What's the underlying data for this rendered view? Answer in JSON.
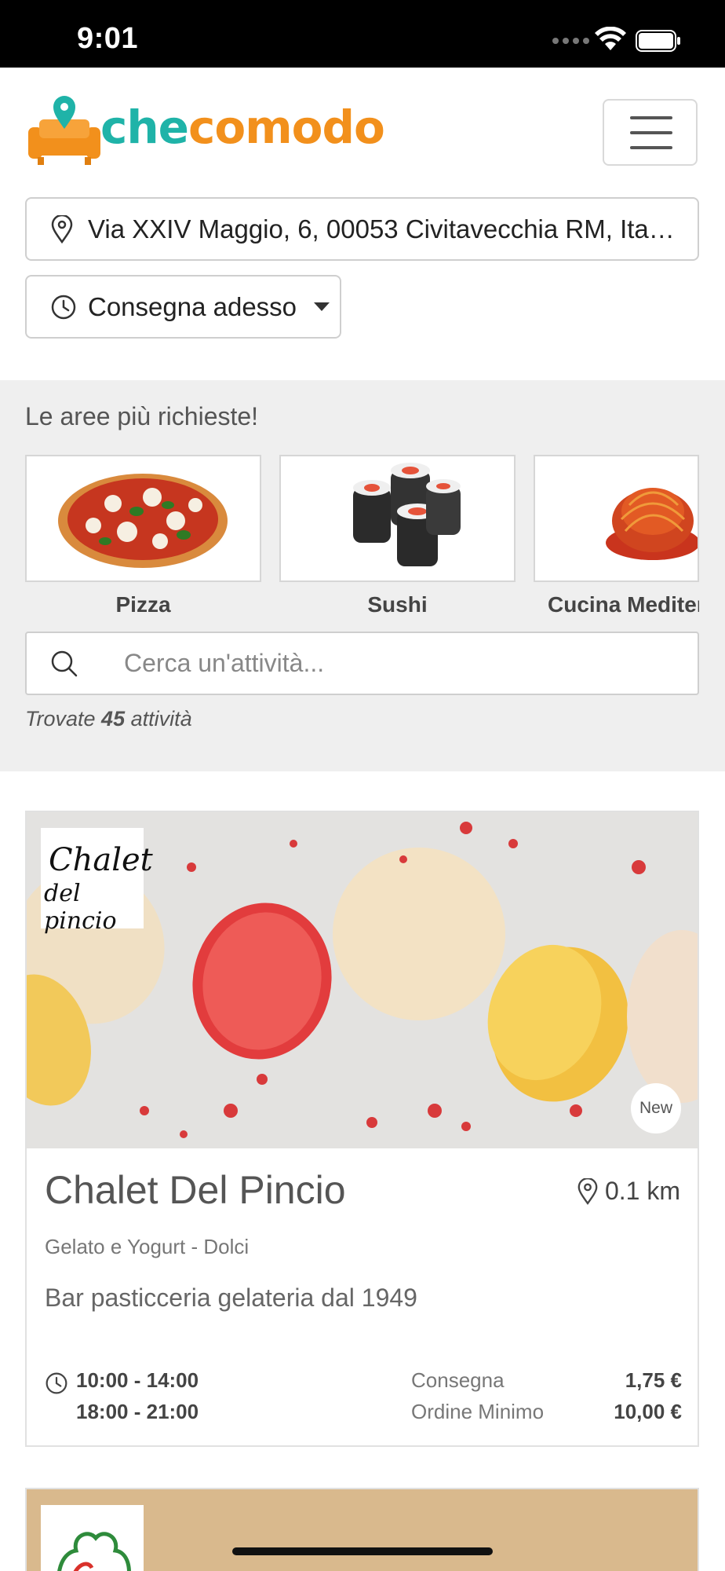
{
  "status_bar": {
    "time": "9:01"
  },
  "header": {
    "logo": {
      "part1": "che",
      "part2": "comodo"
    },
    "menu_icon": "hamburger-menu-icon"
  },
  "address": {
    "value": "Via XXIV Maggio, 6, 00053 Civitavecchia RM, Ita…"
  },
  "delivery": {
    "label": "Consegna adesso"
  },
  "areas": {
    "title": "Le aree più richieste!",
    "categories": [
      {
        "label": "Pizza"
      },
      {
        "label": "Sushi"
      },
      {
        "label": "Cucina Mediter"
      }
    ]
  },
  "search": {
    "placeholder": "Cerca un'attività..."
  },
  "results": {
    "prefix": "Trovate",
    "count": "45",
    "suffix": "attività"
  },
  "restaurant": {
    "badge_line1": "Chalet",
    "badge_line2": "del pincio",
    "new_label": "New",
    "name": "Chalet Del Pincio",
    "distance": "0.1 km",
    "categories": "Gelato e Yogurt - Dolci",
    "description": "Bar pasticceria gelateria dal 1949",
    "hours": [
      "10:00 - 14:00",
      "18:00 - 21:00"
    ],
    "delivery_label": "Consegna",
    "delivery_fee": "1,75 €",
    "min_order_label": "Ordine Minimo",
    "min_order": "10,00 €"
  },
  "colors": {
    "teal": "#1fb3a8",
    "orange": "#f2901c"
  }
}
